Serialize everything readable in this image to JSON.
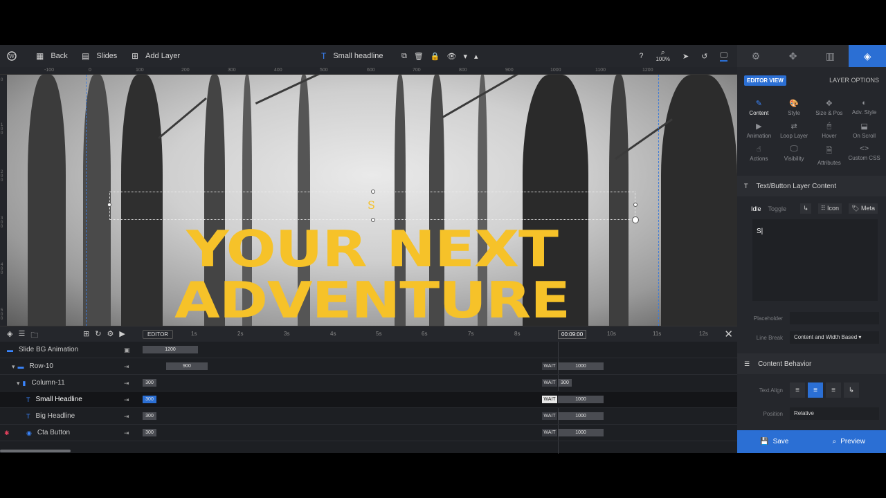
{
  "toolbar": {
    "back": "Back",
    "slides": "Slides",
    "add_layer": "Add Layer",
    "layer_name": "Small headline",
    "zoom": "100%"
  },
  "ruler_top": [
    "-100",
    "0",
    "100",
    "200",
    "300",
    "400",
    "500",
    "600",
    "700",
    "800",
    "900",
    "1000",
    "1100",
    "1200"
  ],
  "ruler_left": [
    "0",
    "1\n0\n0",
    "2\n0\n0",
    "3\n0\n0",
    "4\n0\n0",
    "5\n0\n0"
  ],
  "canvas": {
    "selected_text": "S",
    "headline_line1": "YOUR NEXT",
    "headline_line2": "ADVENTURE"
  },
  "timeline": {
    "editor_label": "EDITOR",
    "ticks": [
      "1s",
      "2s",
      "3s",
      "4s",
      "5s",
      "6s",
      "7s",
      "8s",
      "10s",
      "11s",
      "12s"
    ],
    "current_time": "00:09:00",
    "rows": [
      {
        "label": "Slide BG Animation",
        "start": "1200",
        "wait": "",
        "end": ""
      },
      {
        "label": "Row-10",
        "start": "900",
        "wait": "WAIT",
        "end": "1000"
      },
      {
        "label": "Column-11",
        "start": "300",
        "wait": "WAIT",
        "end": "300"
      },
      {
        "label": "Small Headline",
        "start": "300",
        "wait": "WAIT",
        "end": "1000"
      },
      {
        "label": "Big Headline",
        "start": "300",
        "wait": "WAIT",
        "end": "1000"
      },
      {
        "label": "Cta Button",
        "start": "300",
        "wait": "WAIT",
        "end": "1000"
      }
    ]
  },
  "panel": {
    "editor_view": "EDITOR VIEW",
    "layer_options": "LAYER OPTIONS",
    "grid": [
      {
        "label": "Content"
      },
      {
        "label": "Style"
      },
      {
        "label": "Size & Pos"
      },
      {
        "label": "Adv. Style"
      },
      {
        "label": "Animation"
      },
      {
        "label": "Loop Layer"
      },
      {
        "label": "Hover"
      },
      {
        "label": "On Scroll"
      },
      {
        "label": "Actions"
      },
      {
        "label": "Visibility"
      },
      {
        "label": "Attributes"
      },
      {
        "label": "Custom CSS"
      }
    ],
    "section_content": "Text/Button Layer Content",
    "idle": "Idle",
    "toggle": "Toggle",
    "icon_btn": "Icon",
    "meta_btn": "Meta",
    "text_value": "S|",
    "placeholder_label": "Placeholder",
    "placeholder_value": "",
    "line_break_label": "Line Break",
    "line_break_value": "Content and Width Based",
    "section_behavior": "Content Behavior",
    "text_align_label": "Text Align",
    "position_label": "Position",
    "position_value": "Relative",
    "save": "Save",
    "preview": "Preview"
  },
  "colors": {
    "accent": "#2b6fd4",
    "headline": "#f6c229",
    "bg": "#1d1f23"
  }
}
